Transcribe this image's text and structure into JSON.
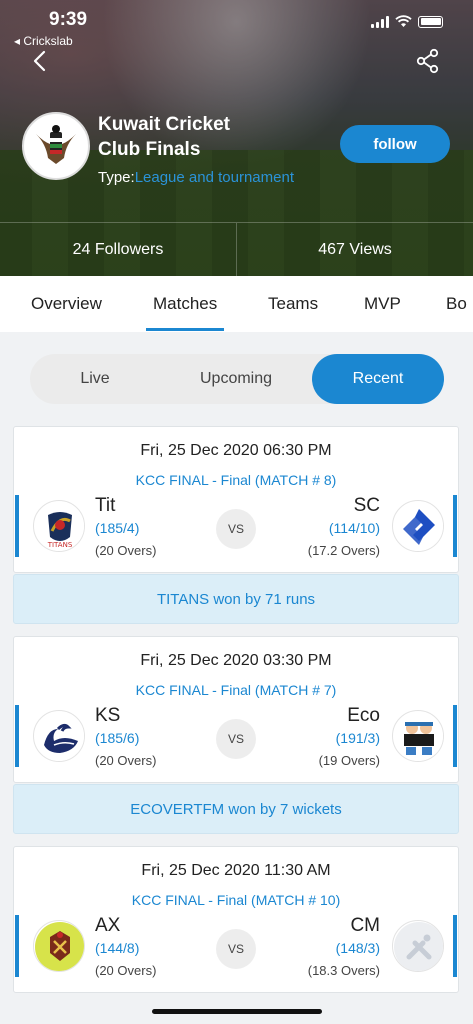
{
  "status_bar": {
    "time": "9:39",
    "back_app": "◂ Crickslab"
  },
  "header": {
    "title_line1": "Kuwait Cricket",
    "title_line2": "Club Finals",
    "type_label": "Type:",
    "type_value": "League and tournament",
    "follow_label": "follow",
    "followers": "24 Followers",
    "views": "467 Views"
  },
  "tabs": [
    "Overview",
    "Matches",
    "Teams",
    "MVP",
    "Bo"
  ],
  "active_tab": "Matches",
  "segments": [
    "Live",
    "Upcoming",
    "Recent"
  ],
  "active_segment": "Recent",
  "matches": [
    {
      "date": "Fri, 25 Dec 2020 06:30 PM",
      "stage": "KCC FINAL - Final (MATCH # 8)",
      "team_a": {
        "abbr": "Tit",
        "score": "(185/4)",
        "overs": "(20 Overs)",
        "logo_icon": "titans-logo"
      },
      "team_b": {
        "abbr": "SC",
        "score": "(114/10)",
        "overs": "(17.2 Overs)",
        "logo_icon": "sc-logo"
      },
      "vs": "VS",
      "result": "TITANS won by 71 runs"
    },
    {
      "date": "Fri, 25 Dec 2020 03:30 PM",
      "stage": "KCC FINAL - Final (MATCH # 7)",
      "team_a": {
        "abbr": "KS",
        "score": "(185/6)",
        "overs": "(20 Overs)",
        "logo_icon": "swan-logo"
      },
      "team_b": {
        "abbr": "Eco",
        "score": "(191/3)",
        "overs": "(19 Overs)",
        "logo_icon": "ecovertfm-logo"
      },
      "vs": "VS",
      "result": "ECOVERTFM won by 7 wickets"
    },
    {
      "date": "Fri, 25 Dec 2020 11:30 AM",
      "stage": "KCC FINAL - Final (MATCH # 10)",
      "team_a": {
        "abbr": "AX",
        "score": "(144/8)",
        "overs": "(20 Overs)",
        "logo_icon": "ax-logo"
      },
      "team_b": {
        "abbr": "CM",
        "score": "(148/3)",
        "overs": "(18.3 Overs)",
        "logo_icon": "cricket-placeholder-icon"
      },
      "vs": "VS"
    }
  ],
  "colors": {
    "accent": "#1b87d1",
    "result_bg": "#dbeef8"
  }
}
